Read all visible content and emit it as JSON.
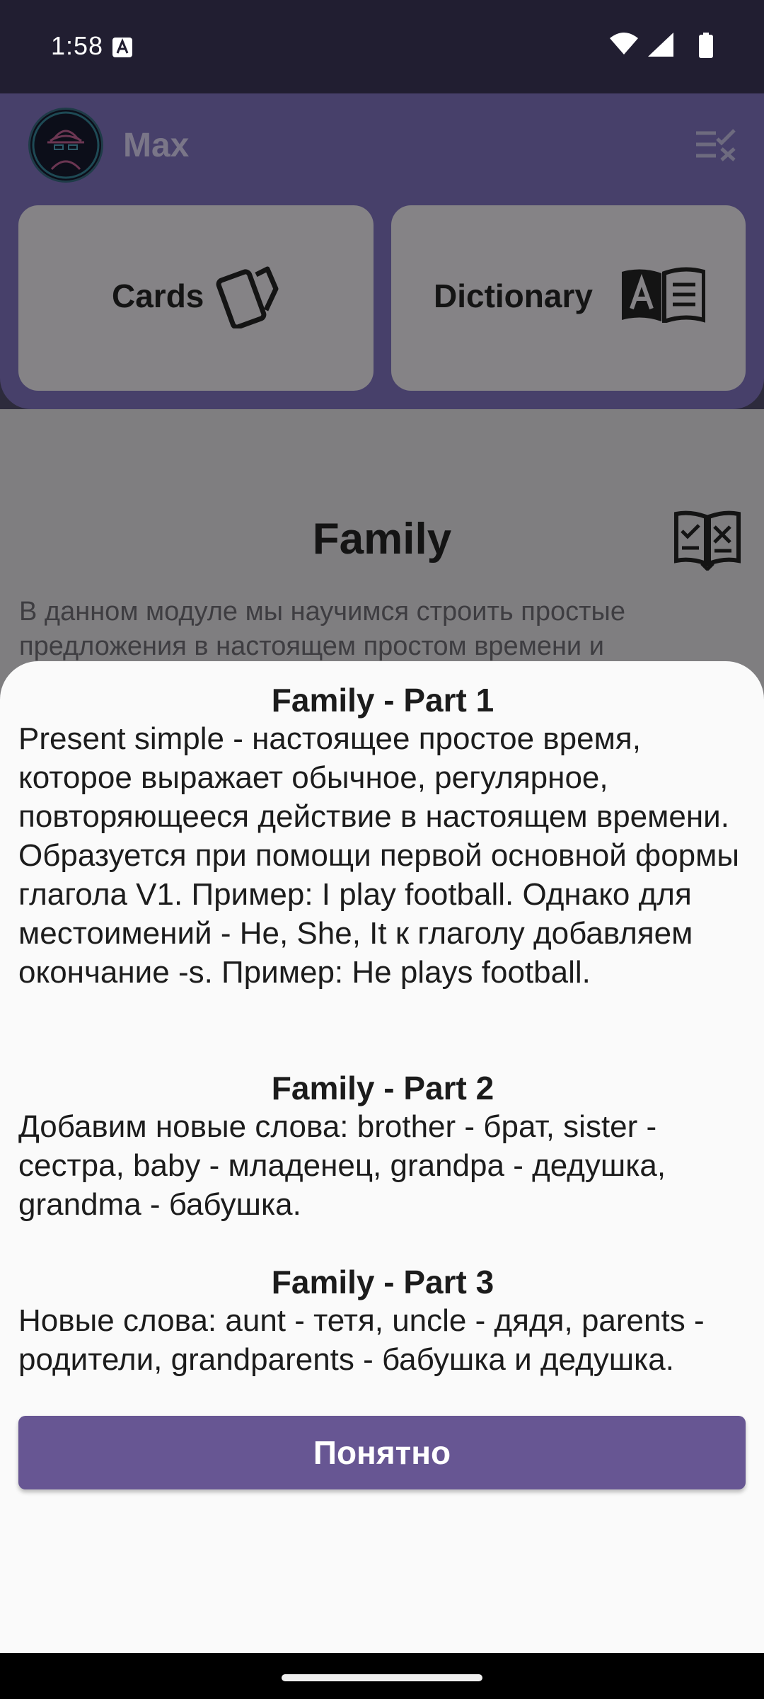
{
  "status_bar": {
    "time": "1:58"
  },
  "header": {
    "user_name": "Max"
  },
  "nav_cards": {
    "cards_label": "Cards",
    "dictionary_label": "Dictionary"
  },
  "module": {
    "title": "Family",
    "description": "В данном модуле мы научимся строить простые предложения в настоящем простом времени и"
  },
  "sheet": {
    "parts": [
      {
        "title": "Family - Part 1",
        "body": "Present simple - настоящее простое время, которое выражает обычное, регулярное, повторяющееся действие в настоящем времени. Образуется при помощи первой основной формы глагола V1. Пример: I play football. Однако для местоимений - He, She, It к глаголу добавляем окончание -s. Пример: He plays football."
      },
      {
        "title": "Family - Part 2",
        "body": "Добавим новые слова: brother - брат, sister - сестра, baby - младенец, grandpa - дедушка, grandma - бабушка."
      },
      {
        "title": "Family - Part 3",
        "body": "Новые слова: aunt - тетя, uncle - дядя, parents - родители, grandparents - бабушка и дедушка."
      }
    ],
    "ok_button": "Понятно"
  },
  "colors": {
    "accent": "#675693",
    "header_dimmed": "#47406a",
    "sheet_background": "#fafafa",
    "status_bar": "#211e31"
  },
  "icons": {
    "status_notification": "text-a-icon",
    "wifi": "wifi-icon",
    "cellular": "cellular-signal-icon",
    "battery": "battery-icon",
    "menu": "checklist-close-icon",
    "cards": "cards-icon",
    "dictionary": "book-a-icon",
    "quiz": "book-check-icon"
  }
}
